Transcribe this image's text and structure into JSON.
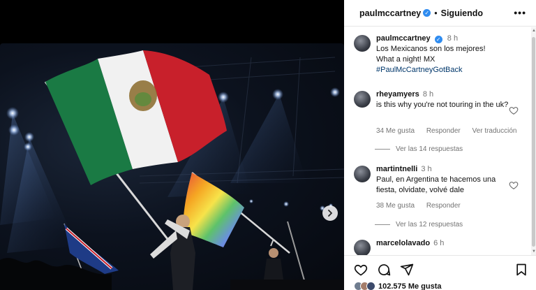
{
  "header": {
    "username": "paulmccartney",
    "separator": "•",
    "following_label": "Siguiendo",
    "more_label": "•••"
  },
  "caption": {
    "username": "paulmccartney",
    "time": "8 h",
    "line1": "Los Mexicanos son los mejores!",
    "line2": "What a night! MX",
    "hashtag": "#PaulMcCartneyGotBack"
  },
  "comments": [
    {
      "username": "rheyamyers",
      "time": "8 h",
      "text": "is this why you're not touring in the uk?",
      "likes": "34 Me gusta",
      "reply_label": "Responder",
      "translate_label": "Ver traducción",
      "replies_label": "Ver las 14 respuestas"
    },
    {
      "username": "martintnelli",
      "time": "3 h",
      "text": "Paul, en Argentina te hacemos una fiesta, olvidate, volvé dale",
      "likes": "38 Me gusta",
      "reply_label": "Responder",
      "replies_label": "Ver las 12 respuestas"
    },
    {
      "username": "marcelolavado",
      "time": "6 h"
    }
  ],
  "actions": {
    "likes_count": "102.575 Me gusta"
  },
  "icons": {
    "next": "chevron-right-icon",
    "like": "heart-icon",
    "comment": "comment-icon",
    "share": "paper-plane-icon",
    "save": "bookmark-icon",
    "verified": "verified-badge-icon",
    "more": "more-options-icon"
  },
  "colors": {
    "accent_blue": "#2f8cf0",
    "hashtag": "#00376b",
    "secondary_text": "#737373",
    "mexico_green": "#1a7a44",
    "mexico_red": "#c8202b"
  }
}
